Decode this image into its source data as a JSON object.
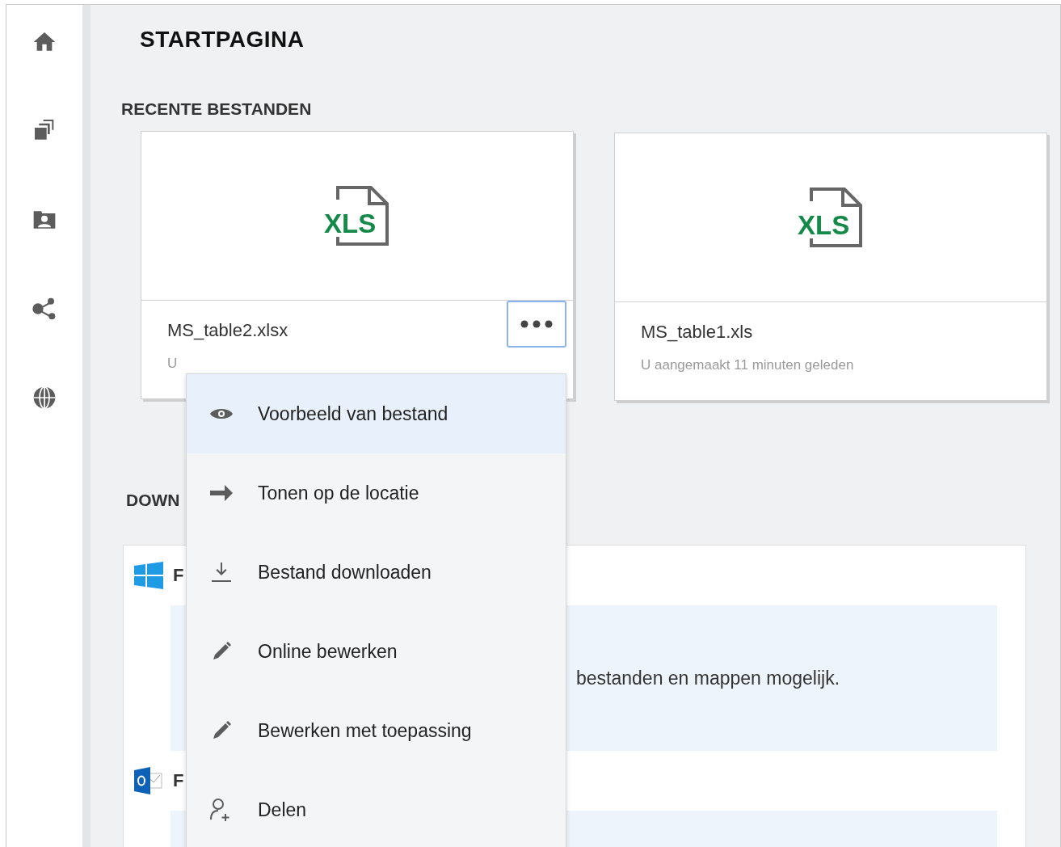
{
  "page": {
    "title": "STARTPAGINA"
  },
  "sidebar": {
    "items": [
      {
        "selected": false
      },
      {
        "selected": false
      },
      {
        "selected": false
      },
      {
        "selected": false
      },
      {
        "selected": false
      }
    ]
  },
  "recent": {
    "heading": "RECENTE BESTANDEN",
    "files": [
      {
        "name": "MS_table2.xlsx",
        "subtitle": "U",
        "badge": "XLS",
        "menu_open": true
      },
      {
        "name": "MS_table1.xls",
        "subtitle": "U aangemaakt 11 minuten geleden",
        "badge": "XLS",
        "menu_open": false
      }
    ]
  },
  "downloads": {
    "heading": "DOWN",
    "rows": [
      {
        "label": "F",
        "note": "bestanden en mappen mogelijk."
      },
      {
        "label": "F"
      }
    ]
  },
  "context_menu": {
    "items": [
      {
        "label": "Voorbeeld van bestand",
        "selected": true
      },
      {
        "label": "Tonen op de locatie",
        "selected": false
      },
      {
        "label": "Bestand downloaden",
        "selected": false
      },
      {
        "label": "Online bewerken",
        "selected": false
      },
      {
        "label": "Bewerken met toepassing",
        "selected": false
      },
      {
        "label": "Delen",
        "selected": false
      }
    ]
  }
}
